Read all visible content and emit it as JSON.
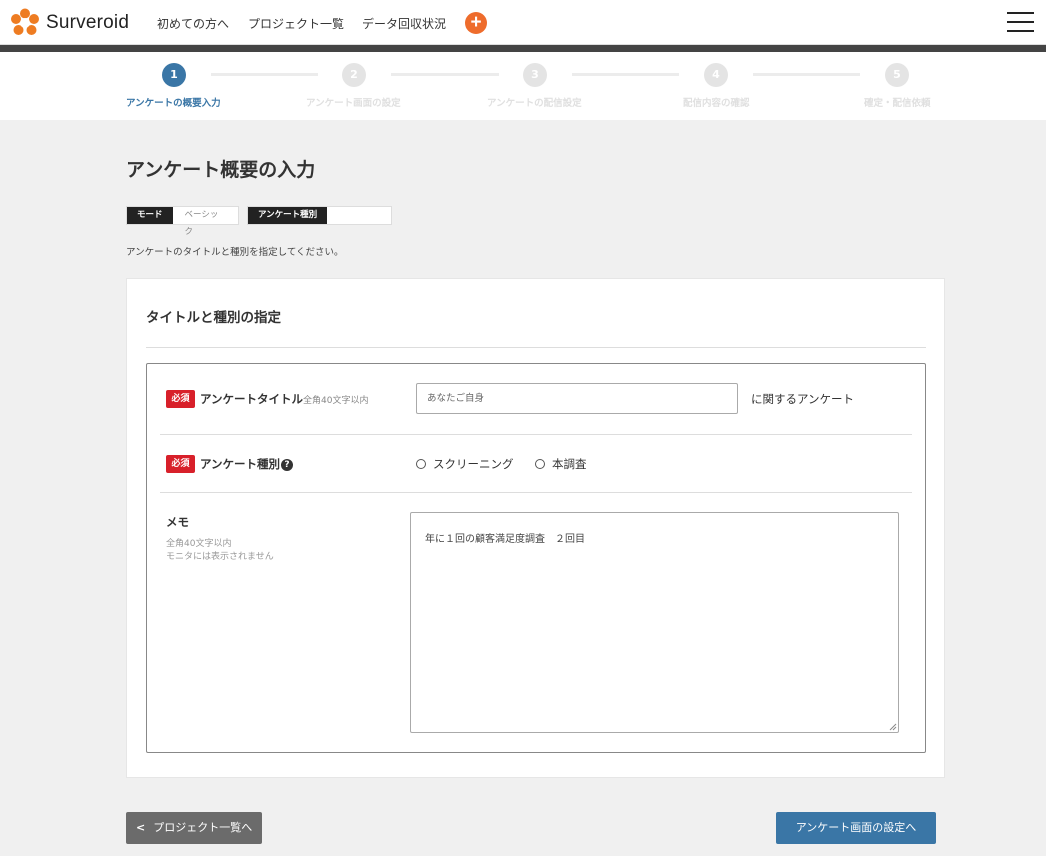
{
  "header": {
    "app_name": "Surveroid",
    "nav": [
      "初めての方へ",
      "プロジェクト一覧",
      "データ回収状況"
    ],
    "add_label": "+"
  },
  "stepper": {
    "steps": [
      {
        "number": "1",
        "label": "アンケートの概要入力"
      },
      {
        "number": "2",
        "label": "アンケート画面の設定"
      },
      {
        "number": "3",
        "label": "アンケートの配信設定"
      },
      {
        "number": "4",
        "label": "配信内容の確認"
      },
      {
        "number": "5",
        "label": "確定・配信依頼"
      }
    ],
    "active_step": 1
  },
  "page": {
    "title": "アンケート概要の入力",
    "mode_label": "モード",
    "mode_value": "ベーシック",
    "type_label": "アンケート種別",
    "type_value": "",
    "instruction": "アンケートのタイトルと種別を指定してください。"
  },
  "card": {
    "title": "タイトルと種別の指定",
    "required_badge": "必須",
    "survey_title_label": "アンケートタイトル",
    "survey_title_note": "全角40文字以内",
    "survey_title_placeholder": "あなたご自身",
    "survey_title_suffix": "に関するアンケート",
    "survey_type_label": "アンケート種別",
    "survey_type_help": "?",
    "survey_type_options": [
      "スクリーニング",
      "本調査"
    ],
    "memo_label": "メモ",
    "memo_note_1": "全角40文字以内",
    "memo_note_2": "モニタには表示されません",
    "memo_value": "年に１回の顧客満足度調査　２回目"
  },
  "footer": {
    "back_label": "プロジェクト一覧へ",
    "back_chevron": "<",
    "next_label": "アンケート画面の設定へ"
  },
  "colors": {
    "brand_orange": "#ee6c2c",
    "primary_blue": "#3a76a6",
    "required_red": "#d8202a",
    "back_gray": "#6b6b6b"
  }
}
